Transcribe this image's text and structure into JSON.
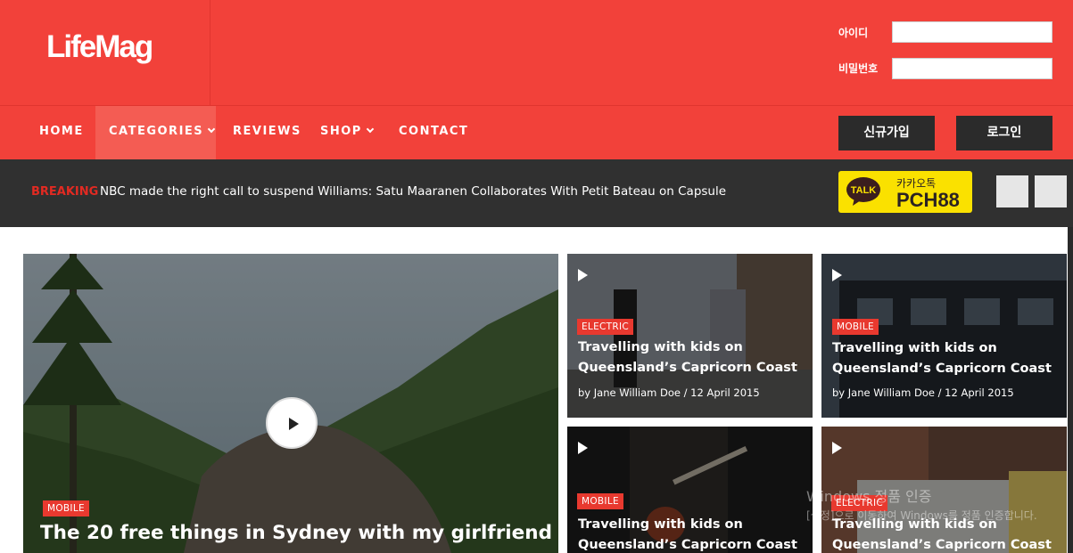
{
  "header": {
    "logo": "LifeMag",
    "login": {
      "id_label": "아이디",
      "pw_label": "비밀번호",
      "id_value": "",
      "pw_value": ""
    }
  },
  "nav": {
    "items": [
      "HOME",
      "CATEGORIES",
      "REVIEWS",
      "SHOP",
      "CONTACT"
    ],
    "signup_label": "신규가입",
    "login_label": "로그인"
  },
  "breaking": {
    "label": "BREAKING",
    "text": "NBC made the right call to suspend Williams: Satu Maaranen Collaborates With Petit Bateau on Capsule"
  },
  "kakao": {
    "bubble": "TALK",
    "label": "카카오톡",
    "id": "PCH88",
    "color": "#fae100"
  },
  "hero": {
    "category": "MOBILE",
    "title": "The 20 free things in Sydney with my girlfriend"
  },
  "cards": [
    {
      "category": "ELECTRIC",
      "title_line1": "Travelling with kids on",
      "title_line2": "Queensland’s Capricorn Coast",
      "meta": "by Jane William Doe /  12 April 2015"
    },
    {
      "category": "MOBILE",
      "title_line1": "Travelling with kids on",
      "title_line2": "Queensland’s Capricorn Coast",
      "meta": "by Jane William Doe /  12 April 2015"
    },
    {
      "category": "MOBILE",
      "title_line1": "Travelling with kids on",
      "title_line2": "Queensland’s Capricorn Coast"
    },
    {
      "category": "ELECTRIC",
      "title_line1": "Travelling with kids on",
      "title_line2": "Queensland’s Capricorn Coast"
    }
  ],
  "watermark": {
    "line1": "Windows 정품 인증",
    "line2": "[설정]으로 이동하여 Windows를 정품 인증합니다."
  },
  "colors": {
    "brand_red": "#f2413a",
    "dark_bar": "#303030",
    "breaking_red": "#e22a22"
  }
}
